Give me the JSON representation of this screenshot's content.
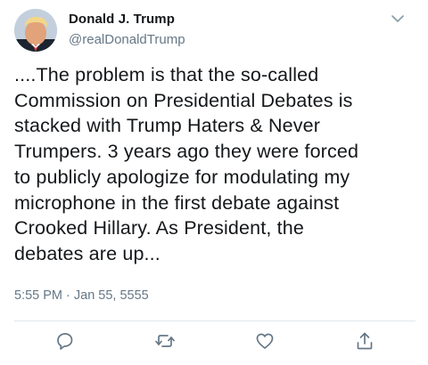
{
  "author": {
    "name": "Donald J. Trump",
    "handle": "@realDonaldTrump"
  },
  "tweet": {
    "lines": [
      "....The problem is that the so-called",
      "Commission on Presidential Debates is",
      "stacked with Trump Haters & Never",
      "Trumpers. 3 years ago they were forced",
      "to publicly apologize for modulating my",
      "microphone in the first debate against",
      "Crooked Hillary. As President, the",
      "debates are up..."
    ],
    "timestamp": "5:55 PM · Jan 55, 5555"
  },
  "actions": {
    "icons": [
      "reply-icon",
      "retweet-icon",
      "like-icon",
      "share-icon"
    ]
  },
  "colors": {
    "text": "#14171a",
    "secondary": "#657786",
    "divider": "#e1e8ed",
    "icon": "#657786"
  }
}
